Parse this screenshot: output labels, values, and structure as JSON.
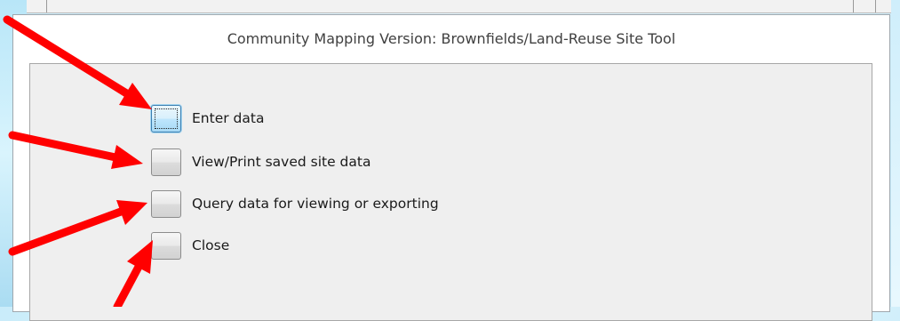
{
  "dialog": {
    "title": "Community Mapping Version: Brownfields/Land-Reuse Site Tool"
  },
  "options": [
    {
      "label": "Enter data",
      "focused": true
    },
    {
      "label": "View/Print saved site data",
      "focused": false
    },
    {
      "label": "Query data for viewing or exporting",
      "focused": false
    },
    {
      "label": "Close",
      "focused": false
    }
  ],
  "colors": {
    "arrow": "#ff0000",
    "focus_border": "#3c7fb1",
    "panel_bg": "#efefef"
  }
}
